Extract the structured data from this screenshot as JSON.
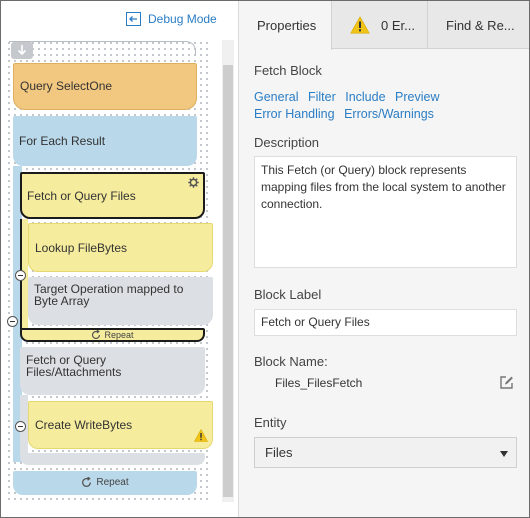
{
  "header": {
    "debug_mode_label": "Debug Mode"
  },
  "canvas": {
    "blocks": {
      "query": "Query SelectOne",
      "for_each": "For Each Result",
      "fetch": "Fetch or Query Files",
      "lookup": "Lookup FileBytes",
      "target": "Target Operation mapped to Byte Array",
      "fetch_repeat": "Repeat",
      "fetch2": "Fetch or Query Files/Attachments",
      "create": "Create WriteBytes",
      "for_each_repeat": "Repeat"
    }
  },
  "tabs": [
    {
      "label": "Properties"
    },
    {
      "label": "0 Er..."
    },
    {
      "label": "Find & Re..."
    }
  ],
  "properties": {
    "section_title": "Fetch Block",
    "links": [
      "General",
      "Filter",
      "Include",
      "Preview",
      "Error Handling",
      "Errors/Warnings"
    ],
    "description_label": "Description",
    "description_value": "This Fetch (or Query) block represents mapping files from the local system to another connection.",
    "block_label_label": "Block Label",
    "block_label_value": "Fetch or Query Files",
    "block_name_label": "Block Name:",
    "block_name_value": "Files_FilesFetch",
    "entity_label": "Entity",
    "entity_value": "Files"
  },
  "colors": {
    "query_block": "#f2c77f",
    "loop_block": "#b9d8ea",
    "yellow_block": "#f6ec9e",
    "gray_block": "#dcdfe3",
    "link": "#2a7dc4",
    "warning": "#f0c419"
  }
}
